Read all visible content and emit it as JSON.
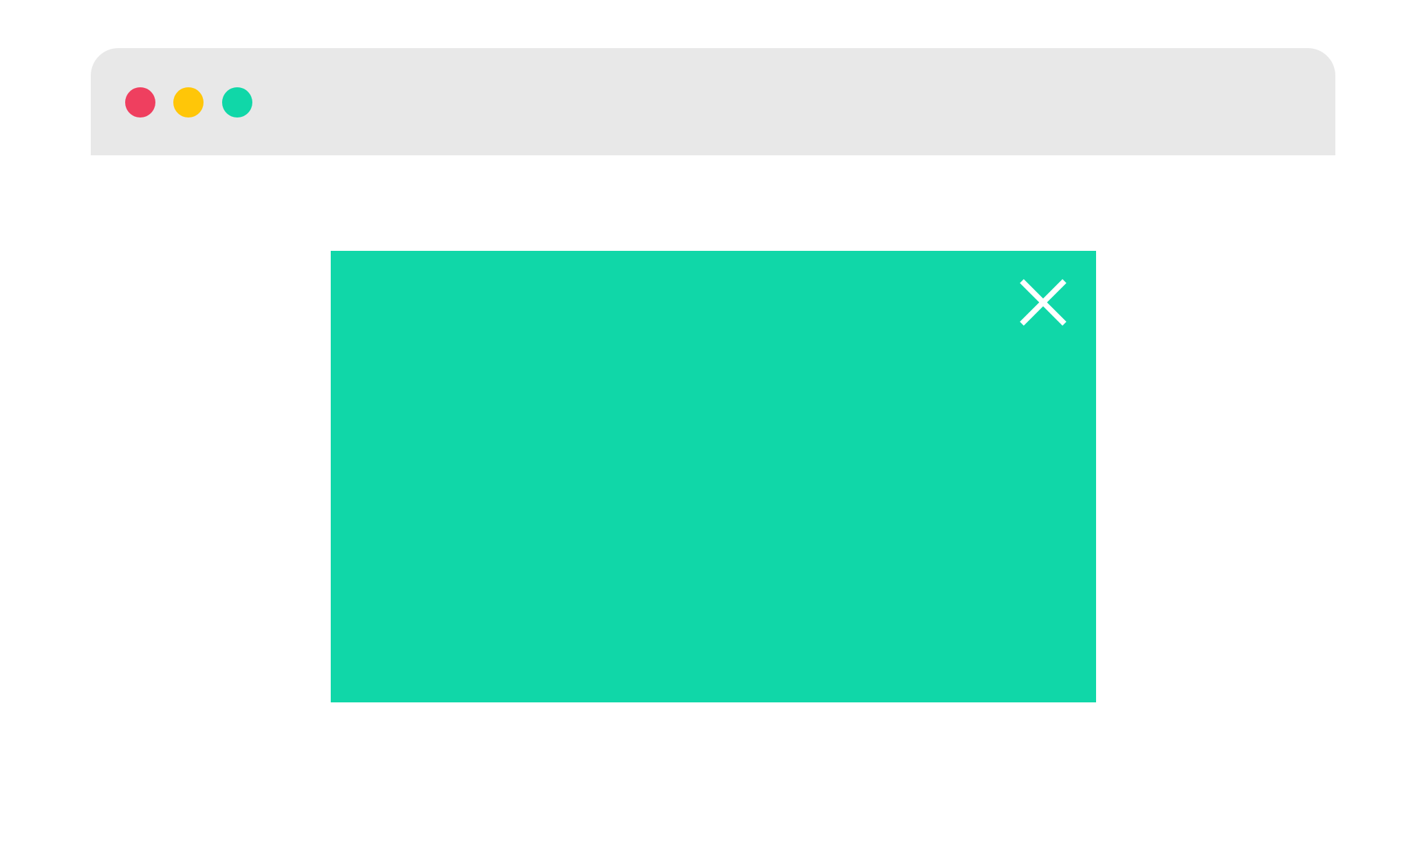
{
  "window": {
    "controls": [
      {
        "name": "close",
        "icon": "close-dot-icon",
        "color": "#ef3f5f"
      },
      {
        "name": "minimize",
        "icon": "minimize-dot-icon",
        "color": "#ffc608"
      },
      {
        "name": "maximize",
        "icon": "maximize-dot-icon",
        "color": "#10d7a8"
      }
    ],
    "titlebar_color": "#e8e8e8",
    "background_color": "#ffffff"
  },
  "popup": {
    "background_color": "#10d7a8",
    "close_icon": "close-icon",
    "close_icon_color": "#ffffff"
  }
}
